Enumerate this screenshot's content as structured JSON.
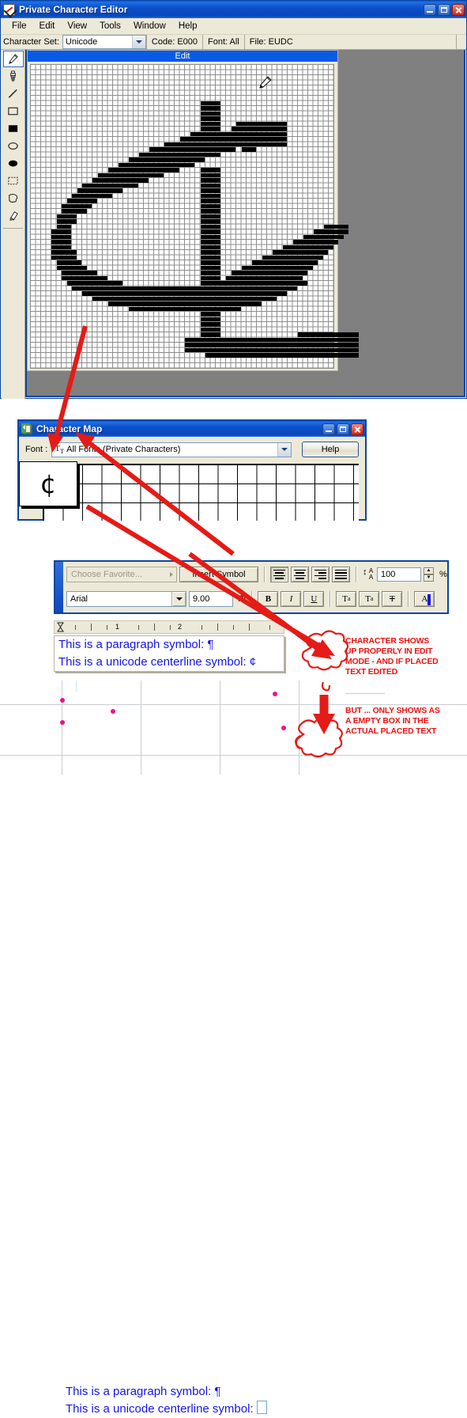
{
  "pce": {
    "title": "Private Character Editor",
    "icon": "pce-app-icon",
    "window_buttons": [
      "minimize",
      "maximize",
      "close"
    ],
    "menu": [
      "File",
      "Edit",
      "View",
      "Tools",
      "Window",
      "Help"
    ],
    "status": {
      "charset_label": "Character Set:",
      "charset_value": "Unicode",
      "code": "Code: E000",
      "font": "Font: All",
      "file": "File: EUDC"
    },
    "tools": [
      {
        "name": "pencil-tool",
        "selected": true
      },
      {
        "name": "brush-tool",
        "selected": false
      },
      {
        "name": "straight-line-tool",
        "selected": false
      },
      {
        "name": "hollow-rectangle-tool",
        "selected": false
      },
      {
        "name": "filled-rectangle-tool",
        "selected": false
      },
      {
        "name": "hollow-ellipse-tool",
        "selected": false
      },
      {
        "name": "filled-ellipse-tool",
        "selected": false
      },
      {
        "name": "rectangular-selection-tool",
        "selected": false
      },
      {
        "name": "freeform-selection-tool",
        "selected": false
      },
      {
        "name": "eraser-tool",
        "selected": false
      }
    ],
    "child_window_title": "Edit",
    "grid": {
      "cols": 59,
      "rows": 59,
      "cell": 6.5
    }
  },
  "charmap": {
    "title": "Character Map",
    "font_label": "Font :",
    "font_value": "All Fonts (Private Characters)",
    "help_label": "Help",
    "zoom_glyph": "¢",
    "window_buttons": [
      "minimize",
      "maximize",
      "close"
    ]
  },
  "editor": {
    "favorite_placeholder": "Choose Favorite...",
    "insert_symbol_label": "Insert Symbol",
    "align_buttons": [
      "align-left",
      "align-center",
      "align-right",
      "align-justify"
    ],
    "active_align": "align-left",
    "leading_value": "100",
    "leading_unit": "%",
    "font_name": "Arial",
    "font_size": "9.00",
    "font_size_unit": "Pt",
    "style_buttons": [
      "B",
      "I",
      "U"
    ],
    "script_buttons": [
      "superscript",
      "subscript",
      "strikethrough"
    ],
    "color_button": "A"
  },
  "ruler": {
    "ticks": [
      "1",
      "2"
    ]
  },
  "edit_mode_text": {
    "line1": "This is a paragraph symbol: ¶",
    "line2_prefix": "This is a unicode centerline symbol:",
    "line2_glyph": "¢"
  },
  "placed_text": {
    "line1": "This is a paragraph symbol: ¶",
    "line2_prefix": "This is a unicode centerline symbol:",
    "line2_glyph": "empty-box"
  },
  "annotations": {
    "top": "CHARACTER SHOWS UP PROPERLY IN EDIT MODE - AND IF PLACED TEXT EDITED",
    "top_lines": [
      "CHARACTER SHOWS",
      "UP PROPERLY IN EDIT",
      "MODE - AND IF PLACED",
      "TEXT EDITED"
    ],
    "bottom": "BUT ... ONLY SHOWS AS A EMPTY BOX IN THE ACTUAL PLACED TEXT",
    "bottom_lines": [
      "BUT ... ONLY SHOWS AS",
      "A EMPTY BOX IN THE",
      "ACTUAL PLACED TEXT"
    ]
  },
  "colors": {
    "title_blue": "#0a4fc9",
    "face": "#ece9d8",
    "mdi_gray": "#808080",
    "annotation_red": "#ee1111",
    "text_blue": "#1414f0",
    "handle_magenta": "#ee1289"
  },
  "glyph_rows": [
    {
      "y": 7,
      "runs": [
        [
          33,
          4
        ]
      ]
    },
    {
      "y": 8,
      "runs": [
        [
          33,
          4
        ]
      ]
    },
    {
      "y": 9,
      "runs": [
        [
          33,
          4
        ]
      ]
    },
    {
      "y": 10,
      "runs": [
        [
          33,
          4
        ]
      ]
    },
    {
      "y": 11,
      "runs": [
        [
          33,
          4
        ],
        [
          40,
          10
        ]
      ]
    },
    {
      "y": 12,
      "runs": [
        [
          33,
          4
        ],
        [
          39,
          11
        ]
      ]
    },
    {
      "y": 13,
      "runs": [
        [
          31,
          19
        ]
      ]
    },
    {
      "y": 14,
      "runs": [
        [
          29,
          21
        ]
      ]
    },
    {
      "y": 15,
      "runs": [
        [
          26,
          24
        ]
      ]
    },
    {
      "y": 16,
      "runs": [
        [
          23,
          17
        ],
        [
          41,
          3
        ]
      ]
    },
    {
      "y": 17,
      "runs": [
        [
          21,
          16
        ]
      ]
    },
    {
      "y": 18,
      "runs": [
        [
          19,
          15
        ]
      ]
    },
    {
      "y": 19,
      "runs": [
        [
          17,
          15
        ]
      ]
    },
    {
      "y": 20,
      "runs": [
        [
          15,
          14
        ],
        [
          33,
          4
        ]
      ]
    },
    {
      "y": 21,
      "runs": [
        [
          13,
          13
        ],
        [
          33,
          4
        ]
      ]
    },
    {
      "y": 22,
      "runs": [
        [
          12,
          11
        ],
        [
          33,
          4
        ]
      ]
    },
    {
      "y": 23,
      "runs": [
        [
          10,
          11
        ],
        [
          33,
          4
        ]
      ]
    },
    {
      "y": 24,
      "runs": [
        [
          9,
          9
        ],
        [
          33,
          4
        ]
      ]
    },
    {
      "y": 25,
      "runs": [
        [
          8,
          8
        ],
        [
          33,
          4
        ]
      ]
    },
    {
      "y": 26,
      "runs": [
        [
          7,
          6
        ],
        [
          33,
          4
        ]
      ]
    },
    {
      "y": 27,
      "runs": [
        [
          6,
          6
        ],
        [
          33,
          4
        ]
      ]
    },
    {
      "y": 28,
      "runs": [
        [
          6,
          5
        ],
        [
          33,
          4
        ]
      ]
    },
    {
      "y": 29,
      "runs": [
        [
          5,
          4
        ],
        [
          33,
          4
        ]
      ]
    },
    {
      "y": 30,
      "runs": [
        [
          5,
          4
        ],
        [
          33,
          4
        ]
      ]
    },
    {
      "y": 31,
      "runs": [
        [
          5,
          3
        ],
        [
          33,
          4
        ],
        [
          57,
          5
        ]
      ]
    },
    {
      "y": 32,
      "runs": [
        [
          4,
          4
        ],
        [
          33,
          4
        ],
        [
          55,
          7
        ]
      ]
    },
    {
      "y": 33,
      "runs": [
        [
          4,
          4
        ],
        [
          33,
          4
        ],
        [
          53,
          8
        ]
      ]
    },
    {
      "y": 34,
      "runs": [
        [
          4,
          4
        ],
        [
          33,
          4
        ],
        [
          51,
          9
        ]
      ]
    },
    {
      "y": 35,
      "runs": [
        [
          4,
          4
        ],
        [
          33,
          4
        ],
        [
          49,
          10
        ]
      ]
    },
    {
      "y": 36,
      "runs": [
        [
          4,
          5
        ],
        [
          33,
          4
        ],
        [
          47,
          11
        ]
      ]
    },
    {
      "y": 37,
      "runs": [
        [
          4,
          5
        ],
        [
          33,
          4
        ],
        [
          45,
          12
        ]
      ]
    },
    {
      "y": 38,
      "runs": [
        [
          5,
          5
        ],
        [
          33,
          4
        ],
        [
          43,
          13
        ]
      ]
    },
    {
      "y": 39,
      "runs": [
        [
          5,
          6
        ],
        [
          33,
          4
        ],
        [
          41,
          14
        ]
      ]
    },
    {
      "y": 40,
      "runs": [
        [
          6,
          7
        ],
        [
          33,
          4
        ],
        [
          39,
          15
        ]
      ]
    },
    {
      "y": 41,
      "runs": [
        [
          6,
          9
        ],
        [
          33,
          4
        ],
        [
          38,
          15
        ]
      ]
    },
    {
      "y": 42,
      "runs": [
        [
          7,
          11
        ],
        [
          33,
          21
        ]
      ]
    },
    {
      "y": 43,
      "runs": [
        [
          8,
          44
        ]
      ]
    },
    {
      "y": 44,
      "runs": [
        [
          10,
          40
        ]
      ]
    },
    {
      "y": 45,
      "runs": [
        [
          12,
          36
        ]
      ]
    },
    {
      "y": 46,
      "runs": [
        [
          15,
          30
        ]
      ]
    },
    {
      "y": 47,
      "runs": [
        [
          19,
          22
        ]
      ]
    },
    {
      "y": 48,
      "runs": [
        [
          33,
          4
        ]
      ]
    },
    {
      "y": 49,
      "runs": [
        [
          33,
          4
        ]
      ]
    },
    {
      "y": 50,
      "runs": [
        [
          33,
          4
        ]
      ]
    },
    {
      "y": 51,
      "runs": [
        [
          33,
          4
        ]
      ]
    },
    {
      "y": 52,
      "runs": [
        [
          33,
          4
        ],
        [
          52,
          12
        ]
      ]
    },
    {
      "y": 53,
      "runs": [
        [
          30,
          34
        ]
      ]
    },
    {
      "y": 54,
      "runs": [
        [
          30,
          34
        ]
      ]
    },
    {
      "y": 55,
      "runs": [
        [
          30,
          34
        ]
      ]
    },
    {
      "y": 56,
      "runs": [
        [
          34,
          30
        ]
      ]
    }
  ]
}
